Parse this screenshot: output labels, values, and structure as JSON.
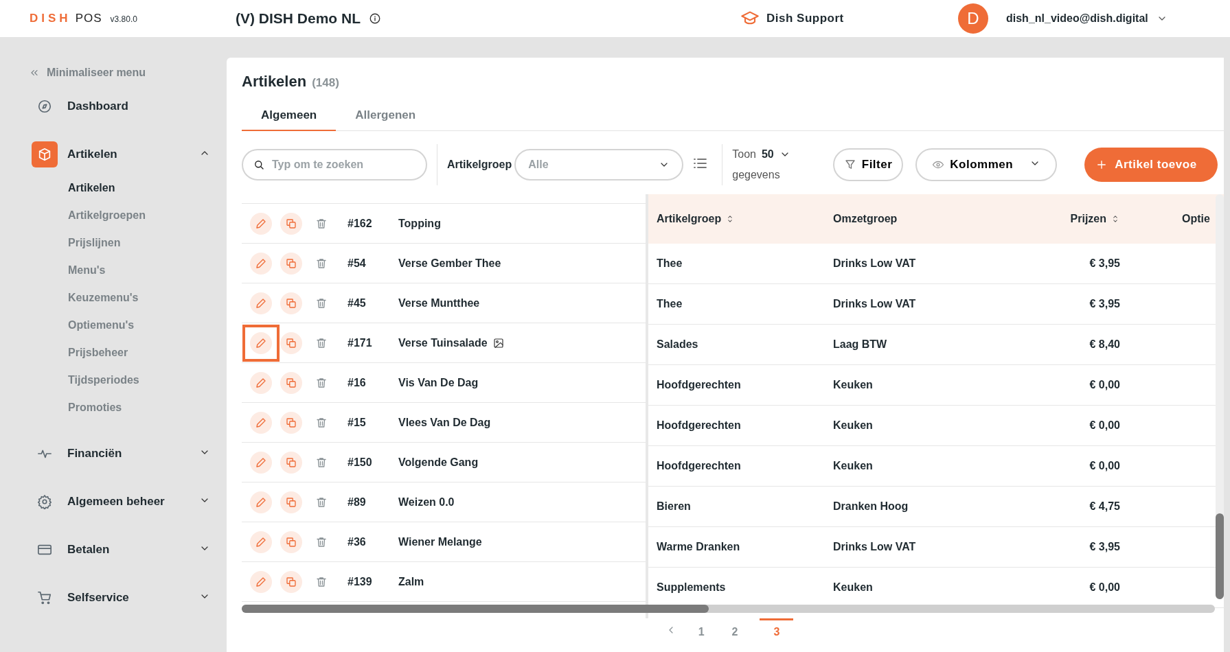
{
  "header": {
    "logo_brand": "DISH",
    "logo_product": "POS",
    "version": "v3.80.0",
    "venue": "(V) DISH Demo NL",
    "support": "Dish Support",
    "avatar_letter": "D",
    "user": "dish_nl_video@dish.digital"
  },
  "sidebar": {
    "collapse": "Minimaliseer menu",
    "items": [
      {
        "label": "Dashboard",
        "selected": false
      },
      {
        "label": "Artikelen",
        "expanded": true,
        "selected": true,
        "children": [
          {
            "label": "Artikelen",
            "selected": true
          },
          {
            "label": "Artikelgroepen",
            "selected": false
          },
          {
            "label": "Prijslijnen",
            "selected": false
          },
          {
            "label": "Menu's",
            "selected": false
          },
          {
            "label": "Keuzemenu's",
            "selected": false
          },
          {
            "label": "Optiemenu's",
            "selected": false
          },
          {
            "label": "Prijsbeheer",
            "selected": false
          },
          {
            "label": "Tijdsperiodes",
            "selected": false
          },
          {
            "label": "Promoties",
            "selected": false
          }
        ]
      },
      {
        "label": "Financiën",
        "expanded": false,
        "selected": false
      },
      {
        "label": "Algemeen beheer",
        "expanded": false,
        "selected": false
      },
      {
        "label": "Betalen",
        "expanded": false,
        "selected": false
      },
      {
        "label": "Selfservice",
        "expanded": false,
        "selected": false
      }
    ]
  },
  "page": {
    "title": "Artikelen",
    "count": "(148)",
    "tabs": [
      {
        "label": "Algemeen",
        "selected": true
      },
      {
        "label": "Allergenen",
        "selected": false
      }
    ],
    "search": {
      "placeholder": "Typ om te zoeken"
    },
    "group_filter": {
      "label": "Artikelgroep",
      "value": "Alle"
    },
    "page_size": {
      "prefix": "Toon",
      "value": "50",
      "suffix": "gegevens"
    },
    "filter_button": "Filter",
    "columns_button": "Kolommen",
    "add_button": "Artikel toevoe"
  },
  "table": {
    "columns": [
      {
        "label": "Artikelgroep",
        "sortable": true
      },
      {
        "label": "Omzetgroep",
        "sortable": false
      },
      {
        "label": "Prijzen",
        "sortable": true
      },
      {
        "label": "Optie",
        "sortable": false
      }
    ],
    "rows": [
      {
        "id": "#162",
        "name": "Topping",
        "has_image": false,
        "highlighted": false
      },
      {
        "id": "#54",
        "name": "Verse Gember Thee",
        "has_image": false,
        "highlighted": false,
        "cells": [
          "Thee",
          "Drinks Low VAT",
          "€ 3,95"
        ]
      },
      {
        "id": "#45",
        "name": "Verse Muntthee",
        "has_image": false,
        "highlighted": false,
        "cells": [
          "Thee",
          "Drinks Low VAT",
          "€ 3,95"
        ]
      },
      {
        "id": "#171",
        "name": "Verse Tuinsalade",
        "has_image": true,
        "highlighted": true,
        "cells": [
          "Salades",
          "Laag BTW",
          "€ 8,40"
        ]
      },
      {
        "id": "#16",
        "name": "Vis Van De Dag",
        "has_image": false,
        "highlighted": false,
        "cells": [
          "Hoofdgerechten",
          "Keuken",
          "€ 0,00"
        ]
      },
      {
        "id": "#15",
        "name": "Vlees Van De Dag",
        "has_image": false,
        "highlighted": false,
        "cells": [
          "Hoofdgerechten",
          "Keuken",
          "€ 0,00"
        ]
      },
      {
        "id": "#150",
        "name": "Volgende Gang",
        "has_image": false,
        "highlighted": false,
        "cells": [
          "Hoofdgerechten",
          "Keuken",
          "€ 0,00"
        ]
      },
      {
        "id": "#89",
        "name": "Weizen 0.0",
        "has_image": false,
        "highlighted": false,
        "cells": [
          "Bieren",
          "Dranken Hoog",
          "€ 4,75"
        ]
      },
      {
        "id": "#36",
        "name": "Wiener Melange",
        "has_image": false,
        "highlighted": false,
        "cells": [
          "Warme Dranken",
          "Drinks Low VAT",
          "€ 3,95"
        ]
      },
      {
        "id": "#139",
        "name": "Zalm",
        "has_image": false,
        "highlighted": false,
        "cells": [
          "Supplements",
          "Keuken",
          "€ 0,00"
        ]
      }
    ]
  },
  "pagination": {
    "pages": [
      {
        "label": "1",
        "selected": false
      },
      {
        "label": "2",
        "selected": false
      },
      {
        "label": "3",
        "selected": true
      }
    ]
  }
}
